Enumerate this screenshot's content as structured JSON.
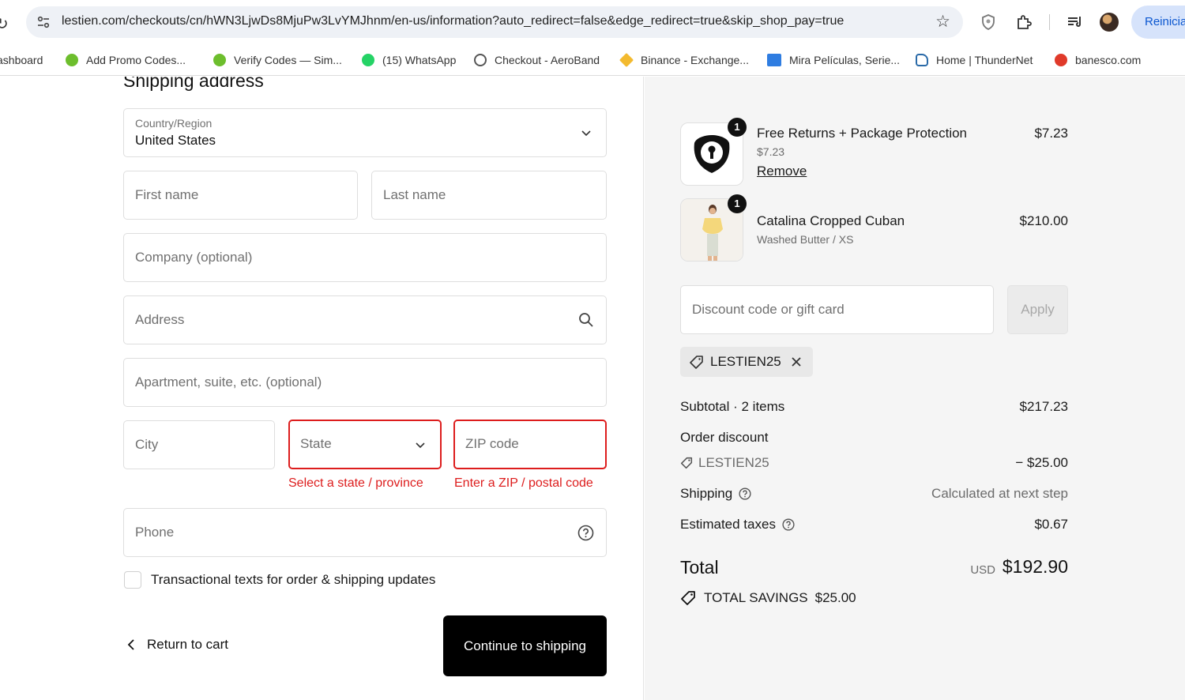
{
  "browser": {
    "url": "lestien.com/checkouts/cn/hWN3LjwDs8MjuPw3LvYMJhnm/en-us/information?auto_redirect=false&edge_redirect=true&skip_shop_pay=true",
    "restart_label": "Reinicia",
    "bookmarks": [
      {
        "label": "ashboard"
      },
      {
        "label": "Add Promo Codes..."
      },
      {
        "label": "Verify Codes — Sim..."
      },
      {
        "label": "(15) WhatsApp"
      },
      {
        "label": "Checkout - AeroBand"
      },
      {
        "label": "Binance - Exchange..."
      },
      {
        "label": "Mira Películas, Serie..."
      },
      {
        "label": "Home | ThunderNet"
      },
      {
        "label": "banesco.com"
      }
    ]
  },
  "form": {
    "section_title": "Shipping address",
    "country": {
      "label": "Country/Region",
      "value": "United States"
    },
    "first_name": "First name",
    "last_name": "Last name",
    "company": "Company (optional)",
    "address": "Address",
    "apartment": "Apartment, suite, etc. (optional)",
    "city": "City",
    "state": "State",
    "zip": "ZIP code",
    "state_error": "Select a state / province",
    "zip_error": "Enter a ZIP / postal code",
    "phone": "Phone",
    "sms_checkbox_label": "Transactional texts for order & shipping updates",
    "return_label": "Return to cart",
    "continue_label": "Continue to shipping"
  },
  "summary": {
    "items": [
      {
        "qty": "1",
        "name": "Free Returns + Package Protection",
        "sub": "$7.23",
        "price": "$7.23",
        "remove_label": "Remove"
      },
      {
        "qty": "1",
        "name": "Catalina Cropped Cuban",
        "sub": "Washed Butter / XS",
        "price": "$210.00"
      }
    ],
    "discount_placeholder": "Discount code or gift card",
    "apply_label": "Apply",
    "applied_code": "LESTIEN25",
    "subtotal_label": "Subtotal · 2 items",
    "subtotal_value": "$217.23",
    "order_discount_label": "Order discount",
    "discount_code": "LESTIEN25",
    "discount_value": "− $25.00",
    "shipping_label": "Shipping",
    "shipping_value": "Calculated at next step",
    "taxes_label": "Estimated taxes",
    "taxes_value": "$0.67",
    "total_label": "Total",
    "total_currency": "USD",
    "total_value": "$192.90",
    "savings_label": "TOTAL SAVINGS",
    "savings_value": "$25.00"
  },
  "colors": {
    "error": "#dd1d1d",
    "button": "#000000",
    "summary_bg": "#f5f5f5"
  }
}
